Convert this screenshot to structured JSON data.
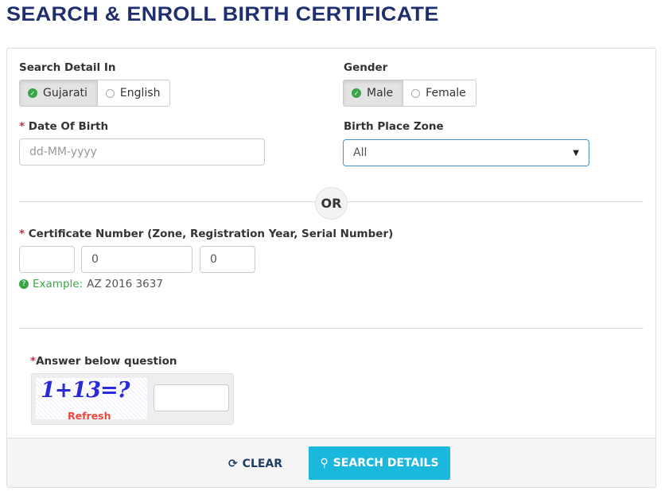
{
  "title": "SEARCH & ENROLL BIRTH CERTIFICATE",
  "search_detail": {
    "label": "Search Detail In",
    "options": [
      "Gujarati",
      "English"
    ],
    "selected": "Gujarati"
  },
  "gender": {
    "label": "Gender",
    "options": [
      "Male",
      "Female"
    ],
    "selected": "Male"
  },
  "dob": {
    "required": "*",
    "label": "Date Of Birth",
    "placeholder": "dd-MM-yyyy",
    "value": ""
  },
  "zone": {
    "label": "Birth Place Zone",
    "value": "All"
  },
  "or": "OR",
  "cert": {
    "required": "*",
    "label": "Certificate Number (Zone, Registration Year, Serial Number)",
    "zone": "",
    "year": "0",
    "serial": "0",
    "example_label": "Example:",
    "example_value": "AZ 2016 3637"
  },
  "captcha": {
    "required": "*",
    "label": "Answer below question",
    "question": "1+13=?",
    "refresh": "Refresh",
    "answer": ""
  },
  "footer": {
    "clear": "CLEAR",
    "search": "SEARCH DETAILS"
  },
  "colors": {
    "title": "#1f2f6e",
    "accent": "#1ab8dc",
    "check": "#3aa548",
    "required": "#d9263f"
  }
}
